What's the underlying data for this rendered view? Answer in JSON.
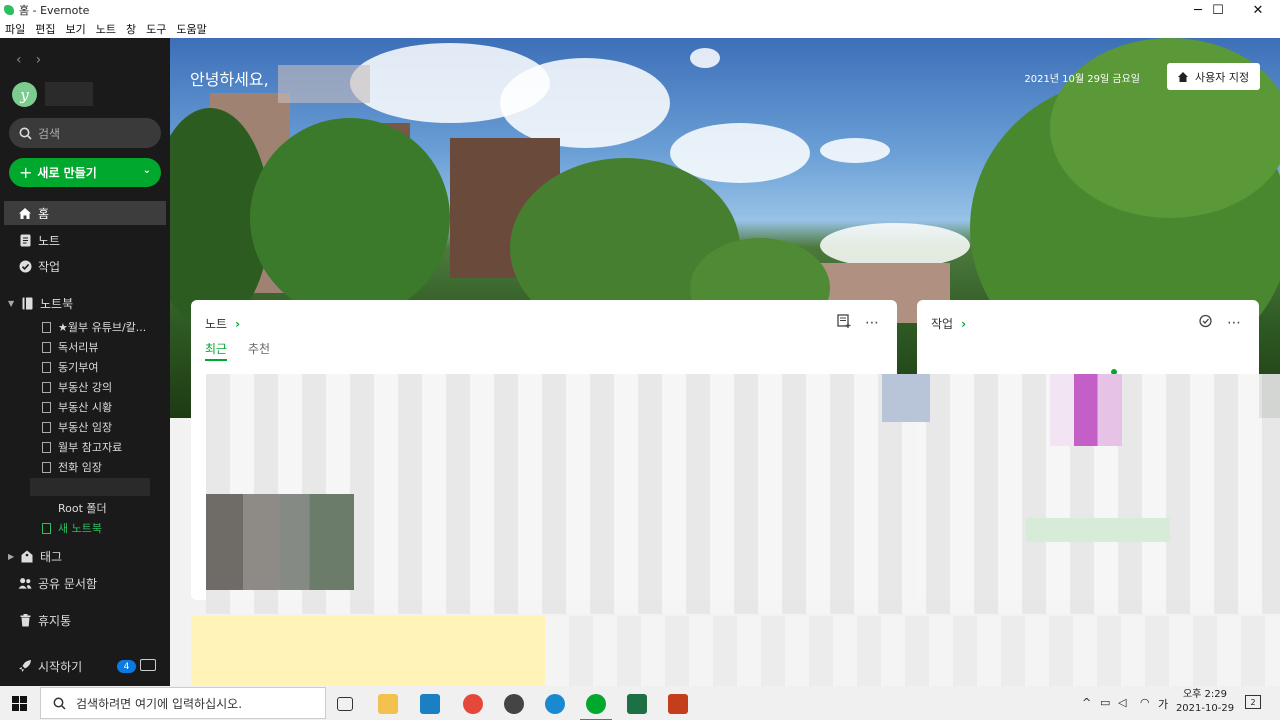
{
  "window": {
    "title": "홈 - Evernote",
    "controls": {
      "minimize": "─",
      "maximize": "☐",
      "close": "✕"
    }
  },
  "menu": [
    "파일",
    "편집",
    "보기",
    "노트",
    "창",
    "도구",
    "도움말"
  ],
  "sidebar": {
    "avatar_letter": "y",
    "search_placeholder": "검색",
    "new_button": "새로 만들기",
    "nav": {
      "home": "홈",
      "notes": "노트",
      "tasks": "작업",
      "notebooks": "노트북",
      "tags": "태그",
      "shared": "공유 문서함",
      "trash": "휴지통",
      "get_started": "시작하기"
    },
    "notebooks": [
      "★월부 유튜브/칼...",
      "독서리뷰",
      "동기부여",
      "부동산 강의",
      "부동산 시황",
      "부동산 임장",
      "월부 참고자료",
      "전화 임장"
    ],
    "root_folder": "Root 폴더",
    "new_notebook": "새 노트북",
    "get_started_badge": "4"
  },
  "hero": {
    "greeting": "안녕하세요,",
    "date": "2021년 10월 29일 금요일",
    "customize_button": "사용자 지정"
  },
  "notes_card": {
    "title": "노트",
    "tabs": [
      "최근",
      "추천"
    ],
    "active_tab": "최근"
  },
  "tasks_card": {
    "title": "작업"
  },
  "taskbar": {
    "search_placeholder": "검색하려면 여기에 입력하십시오.",
    "time": "오후 2:29",
    "date": "2021-10-29",
    "notifications": "2",
    "apps": [
      "task-view",
      "file-explorer",
      "store",
      "chrome",
      "capture",
      "edge",
      "evernote",
      "excel",
      "powerpoint"
    ]
  },
  "colors": {
    "accent": "#00a82d",
    "sidebar_bg": "#1a1a1a",
    "badge": "#0b7be4"
  }
}
